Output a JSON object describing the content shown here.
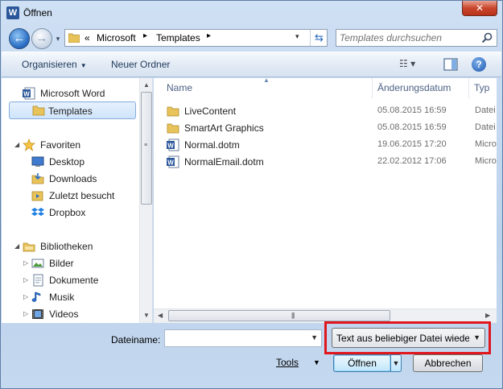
{
  "window": {
    "title": "Öffnen",
    "app_icon_letter": "W",
    "close_glyph": "✕"
  },
  "nav": {
    "back_glyph": "←",
    "forward_glyph": "→",
    "history_glyph": "▾"
  },
  "address": {
    "overflow": "«",
    "crumbs": [
      "Microsoft",
      "Templates"
    ],
    "sep": "▸",
    "dropdown_glyph": "▾",
    "refresh_glyph": "⇆"
  },
  "search": {
    "placeholder": "Templates durchsuchen"
  },
  "toolbar": {
    "organize_label": "Organisieren",
    "new_folder_label": "Neuer Ordner",
    "view_glyph": "☷ ▾",
    "help_glyph": "?"
  },
  "sidebar": {
    "items": [
      {
        "label": "Microsoft Word",
        "icon": "word-doc-icon"
      },
      {
        "label": "Templates",
        "icon": "folder-icon"
      },
      {
        "label": "Favoriten",
        "icon": "star-icon"
      },
      {
        "label": "Desktop",
        "icon": "desktop-icon"
      },
      {
        "label": "Downloads",
        "icon": "downloads-icon"
      },
      {
        "label": "Zuletzt besucht",
        "icon": "recent-places-icon"
      },
      {
        "label": "Dropbox",
        "icon": "dropbox-icon"
      },
      {
        "label": "Bibliotheken",
        "icon": "libraries-icon"
      },
      {
        "label": "Bilder",
        "icon": "pictures-icon"
      },
      {
        "label": "Dokumente",
        "icon": "documents-icon"
      },
      {
        "label": "Musik",
        "icon": "music-icon"
      },
      {
        "label": "Videos",
        "icon": "videos-icon"
      }
    ]
  },
  "files": {
    "columns": [
      "Name",
      "Änderungsdatum",
      "Typ"
    ],
    "rows": [
      {
        "name": "LiveContent",
        "date": "05.08.2015 16:59",
        "type": "Datei",
        "icon": "folder-icon"
      },
      {
        "name": "SmartArt Graphics",
        "date": "05.08.2015 16:59",
        "type": "Datei",
        "icon": "folder-icon"
      },
      {
        "name": "Normal.dotm",
        "date": "19.06.2015 17:20",
        "type": "Micro",
        "icon": "word-template-icon"
      },
      {
        "name": "NormalEmail.dotm",
        "date": "22.02.2012 17:06",
        "type": "Micro",
        "icon": "word-template-icon"
      }
    ]
  },
  "footer": {
    "filename_label": "Dateiname:",
    "filename_value": "",
    "filetype_value": "Text aus beliebiger Datei wieder",
    "tools_label": "Tools",
    "open_label": "Öffnen",
    "cancel_label": "Abbrechen"
  },
  "colors": {
    "highlight": "#e0161d",
    "accent": "#2b579a",
    "folder": "#e8c35a"
  }
}
